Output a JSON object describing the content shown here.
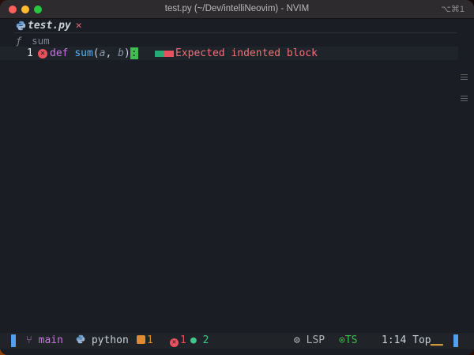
{
  "window": {
    "title": "test.py (~/Dev/intelliNeovim) - NVIM",
    "shortcut": "⌥⌘1"
  },
  "tabline": {
    "tab_label": "test.py",
    "close_glyph": "✕"
  },
  "winbar": {
    "symbol_icon": "ƒ",
    "symbol_name": "sum"
  },
  "buffer": {
    "line_number": "1",
    "code": {
      "keyword": "def",
      "function": "sum",
      "open_paren": "(",
      "param_a": "a",
      "comma": ", ",
      "param_b": "b",
      "close_paren": ")",
      "colon": ":"
    },
    "diagnostic_message": "Expected indented block"
  },
  "statusline": {
    "branch": "main",
    "filetype": "python",
    "warnings": "1",
    "errors": "1",
    "hints": "2",
    "lsp": "LSP",
    "treesitter": "TS",
    "position": "1:14",
    "scroll": "Top",
    "scroll_bar": "▁▁"
  },
  "colors": {
    "accent_blue": "#51a0ef",
    "error": "#e8525f",
    "warning": "#e08b2d",
    "hint": "#3fc88a",
    "ok": "#3fbf4f"
  }
}
